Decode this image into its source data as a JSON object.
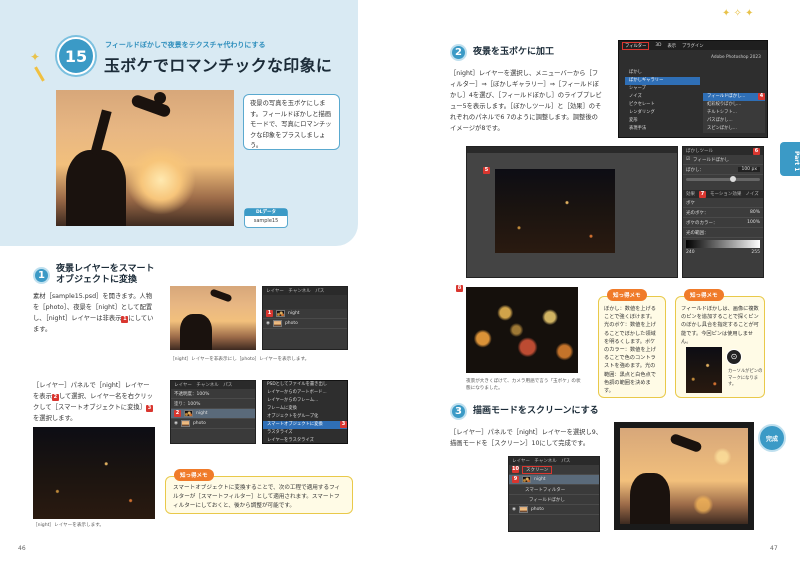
{
  "left_page": {
    "lesson_number": "15",
    "kicker": "フィールドぼかしで夜景をテクスチャ代わりにする",
    "title": "玉ボケでロマンチックな印象に",
    "lead": "夜景の写真を玉ボケにします。フィールドぼかしと描画モードで、写真にロマンチックな印象をプラスしましょう。",
    "dl_label": "DLデータ",
    "dl_file": "sample15",
    "step1": {
      "number": "1",
      "heading": "夜景レイヤーをスマートオブジェクトに変換",
      "text_a": "素材［sample15.psd］を開きます。人物を［photo］、夜景を［night］として配置し、［night］レイヤーは非表示",
      "badge_a": "1",
      "text_a2": "にしています。",
      "caption_a": "［night］レイヤーを非表示にし［photo］レイヤーを表示します。",
      "text_b": "［レイヤー］パネルで［night］レイヤーを表示",
      "badge_b": "2",
      "text_b2": "して選択、レイヤー名を右クリックして［スマートオブジェクトに変換］",
      "badge_c": "3",
      "text_b3": "を選択します。",
      "caption_b": "［night］レイヤーを表示します。"
    },
    "tip": {
      "label": "知っ得メモ",
      "text": "スマートオブジェクトに変換することで、次の工程で適用するフィルターが［スマートフィルター］として適用されます。スマートフィルターにしておくと、後から調整が可能です。"
    },
    "layers_panel_1": {
      "tabs": "レイヤー　チャンネル　パス",
      "rows": [
        "night",
        "photo"
      ],
      "badge": "1"
    },
    "layers_panel_2": {
      "tabs": "レイヤー　チャンネル　パス",
      "rows": [
        "night",
        "photo"
      ],
      "badge": "2",
      "opacity": "不透明度：100%",
      "fill": "塗り：100%"
    },
    "context_menu": {
      "items": [
        "PSDとしてファイルを書き出し",
        "レイヤーからのアートボード...",
        "レイヤーからのフレーム...",
        "フレームに変換",
        "オブジェクトをグループ化",
        "スマートオブジェクトに変換",
        "ラスタライズ",
        "レイヤーをラスタライズ"
      ],
      "badge": "3"
    },
    "page_number": "46"
  },
  "right_page": {
    "step2": {
      "number": "2",
      "heading": "夜景を玉ボケに加工",
      "text": "［night］レイヤーを選択し、メニューバーから［フィルター］⇒［ぼかしギャラリー］⇒［フィールドぼかし］4を選び、［フィールドぼかし］のライブプレビュー5を表示します。［ぼかしツール］と［効果］のそれぞれのパネルで6 7のように調整します。調整後のイメージが8です。",
      "badge_4": "4",
      "badge_5": "5",
      "badge_6": "6",
      "badge_7": "7",
      "badge_8": "8",
      "caption": "夜景が大きくぼけて、カメラ用語で言う「玉ボケ」の状態になりました。"
    },
    "menu": {
      "bar": [
        "フィルター",
        "3D",
        "表示",
        "プラグイン"
      ],
      "items": [
        "ぼかし",
        "ぼかしギャラリー",
        "シャープ",
        "ノイズ",
        "ピクセレート",
        "レンダリング",
        "変形",
        "表現手法",
        "その他"
      ],
      "submenu": [
        "フィールドぼかし...",
        "虹彩絞りぼかし...",
        "チルトシフト...",
        "パスぼかし...",
        "スピンぼかし..."
      ],
      "app": "Adobe Photoshop 2023"
    },
    "blur_panel": {
      "title": "ぼかしツール",
      "field_blur": "フィールドぼかし",
      "blur_label": "ぼかし：",
      "blur_value": "100 px",
      "effect_title": "効果",
      "tabs": [
        "効果",
        "モーション効果",
        "ノイズ"
      ],
      "bokeh": "ボケ",
      "light_bokeh": "光のボケ：",
      "light_value": "80%",
      "bokeh_color": "ボケのカラー：",
      "bokeh_value": "100%",
      "light_range": "光の範囲：",
      "range_low": "240",
      "range_high": "255"
    },
    "tip1": {
      "label": "知っ得メモ",
      "text": "ぼかし：数値を上げることで強くぼけます。光のボケ：数値を上げることでぼかした領域を明るくします。ボケのカラー：数値を上げることで色のコントラストを強めます。光の範囲：黒点と白色点で色調の範囲を決めます。"
    },
    "tip2": {
      "label": "知っ得メモ",
      "text": "フィールドぼかしは、画像に複数のピンを追加することで探くピンのぼかし具合を指定することが可能です。今回ピンは使用しません。",
      "pin_caption": "カーソルがピンのマークになります。"
    },
    "step3": {
      "number": "3",
      "heading": "描画モードをスクリーンにする",
      "text": "［レイヤー］パネルで［night］レイヤーを選択し9、描画モードを［スクリーン］10にして完成です。",
      "badge_9": "9",
      "badge_10": "10"
    },
    "layers_panel_3": {
      "tabs": "レイヤー　チャンネル　パス",
      "mode": "スクリーン",
      "rows": [
        "night",
        "スマートフィルター",
        "フィールドぼかし",
        "photo"
      ],
      "badge_9": "9",
      "badge_10": "10"
    },
    "part_label": "Part 1",
    "done_label": "完成",
    "page_number": "47"
  },
  "colors": {
    "accent": "#3b9ac6",
    "hero_bg": "#d9eaf3",
    "badge_red": "#d9362f",
    "tip_border": "#e9c94a",
    "tip_label": "#f07b2a"
  }
}
